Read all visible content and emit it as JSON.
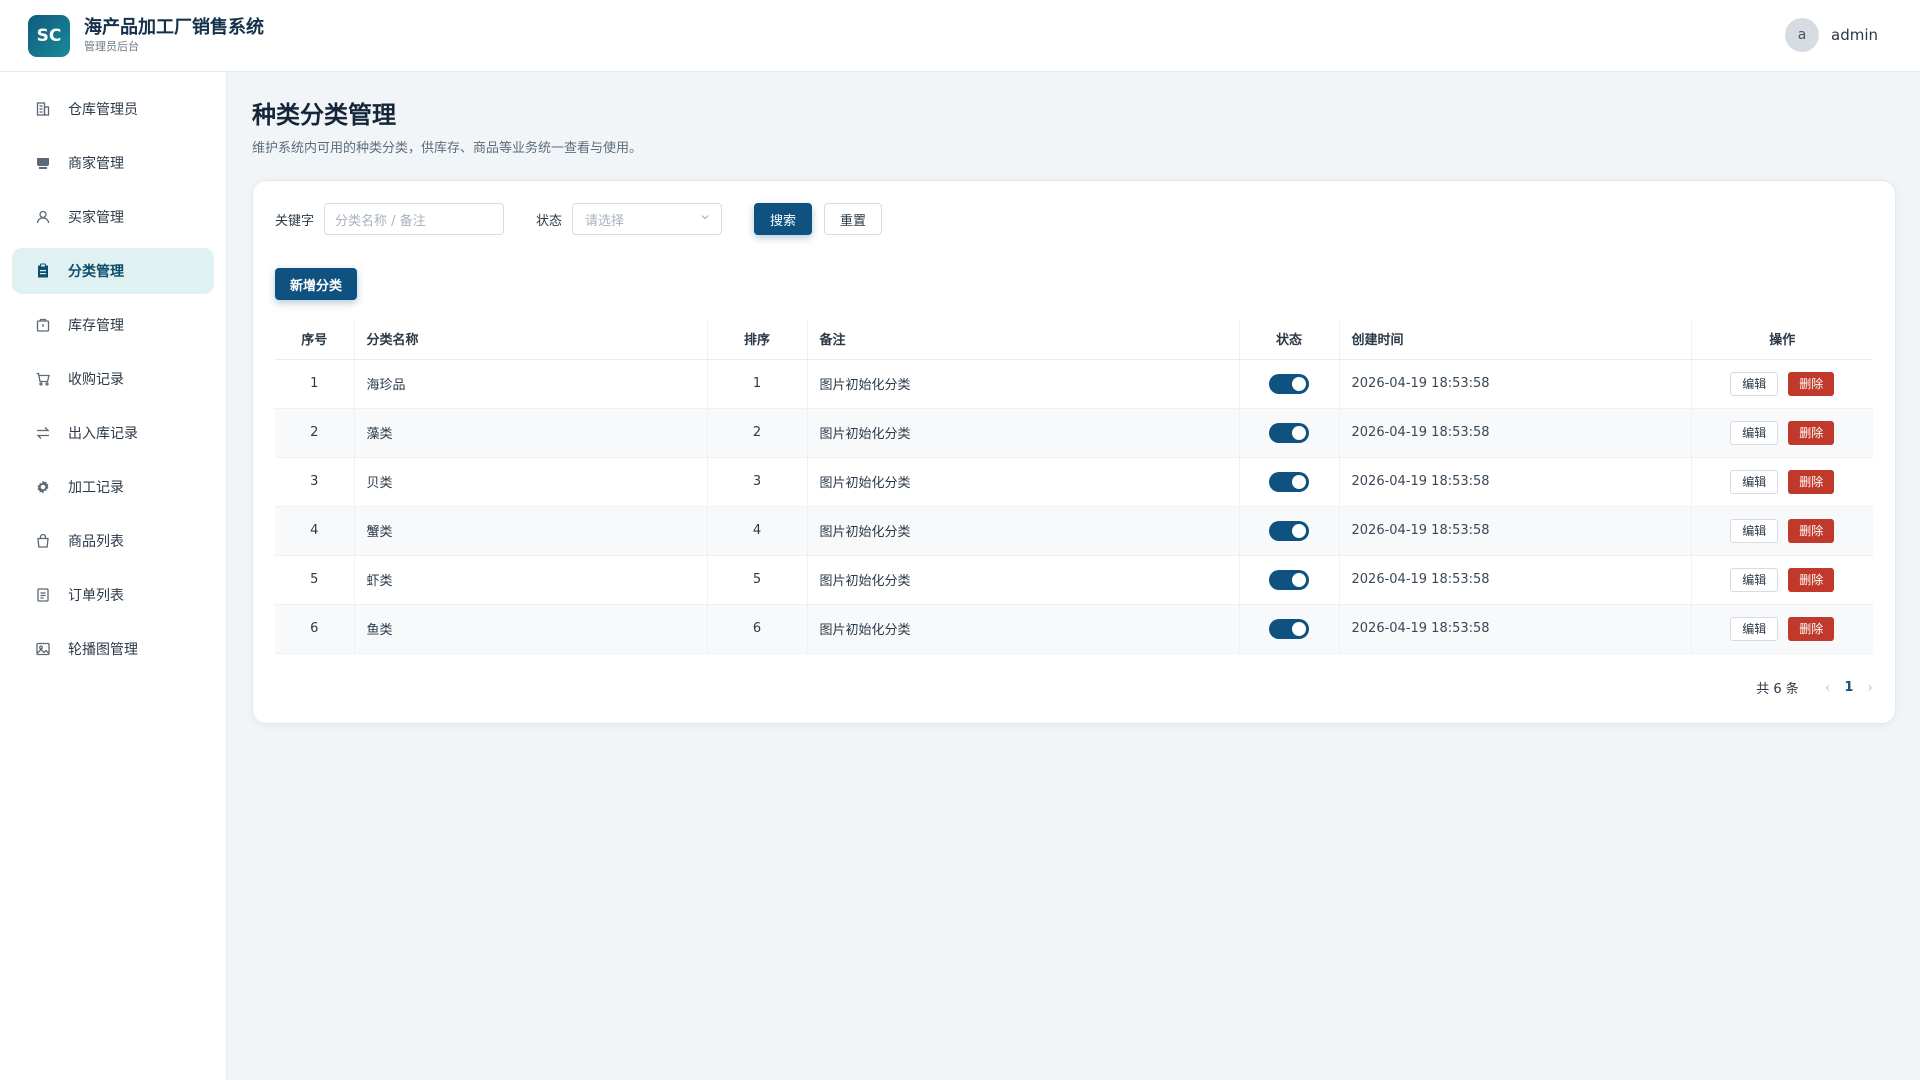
{
  "header": {
    "logo_text": "SC",
    "title": "海产品加工厂销售系统",
    "subtitle": "管理员后台",
    "user_initial": "a",
    "username": "admin"
  },
  "sidebar": {
    "items": [
      {
        "label": "仓库管理员",
        "icon": "building-icon",
        "active": false
      },
      {
        "label": "商家管理",
        "icon": "store-icon",
        "active": false
      },
      {
        "label": "买家管理",
        "icon": "user-icon",
        "active": false
      },
      {
        "label": "分类管理",
        "icon": "clipboard-icon",
        "active": true
      },
      {
        "label": "库存管理",
        "icon": "package-icon",
        "active": false
      },
      {
        "label": "收购记录",
        "icon": "cart-icon",
        "active": false
      },
      {
        "label": "出入库记录",
        "icon": "transfer-icon",
        "active": false
      },
      {
        "label": "加工记录",
        "icon": "gear-icon",
        "active": false
      },
      {
        "label": "商品列表",
        "icon": "bag-icon",
        "active": false
      },
      {
        "label": "订单列表",
        "icon": "document-icon",
        "active": false
      },
      {
        "label": "轮播图管理",
        "icon": "image-icon",
        "active": false
      }
    ]
  },
  "page": {
    "title": "种类分类管理",
    "description": "维护系统内可用的种类分类，供库存、商品等业务统一查看与使用。"
  },
  "filter": {
    "keyword_label": "关键字",
    "keyword_placeholder": "分类名称 / 备注",
    "status_label": "状态",
    "status_placeholder": "请选择",
    "search_label": "搜索",
    "reset_label": "重置"
  },
  "add_button_label": "新增分类",
  "table": {
    "headers": [
      "序号",
      "分类名称",
      "排序",
      "备注",
      "状态",
      "创建时间",
      "操作"
    ],
    "rows": [
      {
        "index": "1",
        "name": "海珍品",
        "sort": "1",
        "remark": "图片初始化分类",
        "enabled": true,
        "created": "2026-04-19 18:53:58"
      },
      {
        "index": "2",
        "name": "藻类",
        "sort": "2",
        "remark": "图片初始化分类",
        "enabled": true,
        "created": "2026-04-19 18:53:58"
      },
      {
        "index": "3",
        "name": "贝类",
        "sort": "3",
        "remark": "图片初始化分类",
        "enabled": true,
        "created": "2026-04-19 18:53:58"
      },
      {
        "index": "4",
        "name": "蟹类",
        "sort": "4",
        "remark": "图片初始化分类",
        "enabled": true,
        "created": "2026-04-19 18:53:58"
      },
      {
        "index": "5",
        "name": "虾类",
        "sort": "5",
        "remark": "图片初始化分类",
        "enabled": true,
        "created": "2026-04-19 18:53:58"
      },
      {
        "index": "6",
        "name": "鱼类",
        "sort": "6",
        "remark": "图片初始化分类",
        "enabled": true,
        "created": "2026-04-19 18:53:58"
      }
    ],
    "edit_label": "编辑",
    "delete_label": "删除"
  },
  "pagination": {
    "total_text": "共 6 条",
    "current_page": "1"
  },
  "colors": {
    "primary": "#0f5280",
    "danger": "#c0392b",
    "active_bg": "#dff1f1"
  }
}
